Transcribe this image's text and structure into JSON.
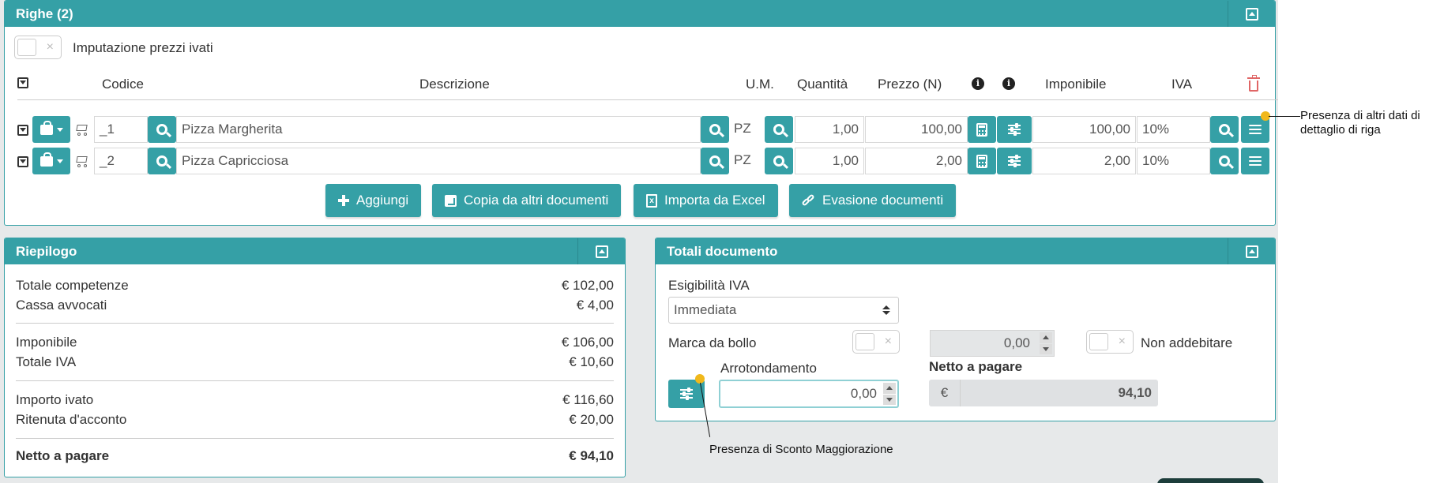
{
  "righe": {
    "title": "Righe (2)",
    "ivati_label": "Imputazione prezzi ivati",
    "columns": {
      "codice": "Codice",
      "descrizione": "Descrizione",
      "um": "U.M.",
      "quantita": "Quantità",
      "prezzo": "Prezzo (N)",
      "imponibile": "Imponibile",
      "iva": "IVA"
    },
    "rows": [
      {
        "codice": "_1",
        "descrizione": "Pizza Margherita",
        "um": "PZ",
        "quantita": "1,00",
        "prezzo": "100,00",
        "imponibile": "100,00",
        "iva": "10%"
      },
      {
        "codice": "_2",
        "descrizione": "Pizza Capricciosa",
        "um": "PZ",
        "quantita": "1,00",
        "prezzo": "2,00",
        "imponibile": "2,00",
        "iva": "10%"
      }
    ],
    "actions": {
      "aggiungi": "Aggiungi",
      "copia": "Copia da altri documenti",
      "importa": "Importa da Excel",
      "evasione": "Evasione documenti"
    }
  },
  "riepilogo": {
    "title": "Riepilogo",
    "lines": [
      {
        "label": "Totale competenze",
        "value": "€ 102,00"
      },
      {
        "label": "Cassa avvocati",
        "value": "€ 4,00"
      },
      {
        "label": "Imponibile",
        "value": "€ 106,00"
      },
      {
        "label": "Totale IVA",
        "value": "€ 10,60"
      },
      {
        "label": "Importo ivato",
        "value": "€ 116,60"
      },
      {
        "label": "Ritenuta d'acconto",
        "value": "€ 20,00"
      }
    ],
    "netto_label": "Netto a pagare",
    "netto_value": "€ 94,10"
  },
  "totali": {
    "title": "Totali documento",
    "esigibilita_label": "Esigibilità IVA",
    "esigibilita_value": "Immediata",
    "marca_label": "Marca da bollo",
    "marca_value": "0,00",
    "non_addebitare_label": "Non addebitare",
    "arrotondamento_label": "Arrotondamento",
    "arrotondamento_value": "0,00",
    "netto_label": "Netto a pagare",
    "currency": "€",
    "netto_value": "94,10"
  },
  "annotations": {
    "dettaglio": "Presenza di altri dati di dettaglio di riga",
    "sconto": "Presenza di Sconto Maggiorazione"
  },
  "colors": {
    "accent": "#35a0a6",
    "marker": "#f0b81b",
    "danger": "#e06666"
  }
}
